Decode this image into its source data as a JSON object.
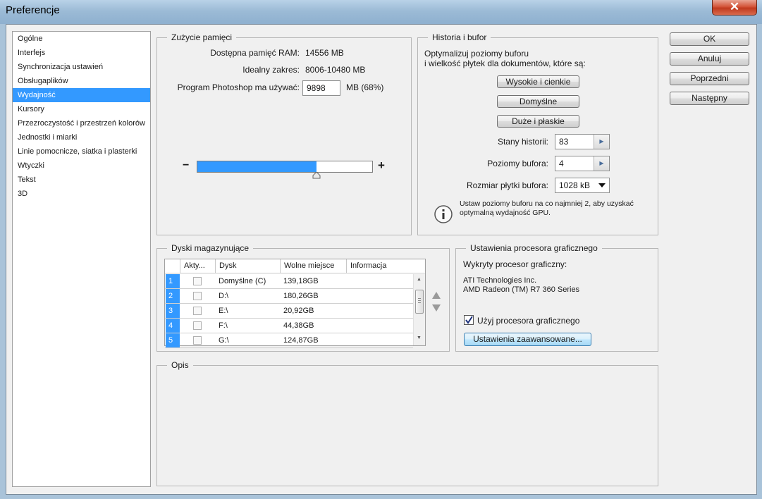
{
  "window": {
    "title": "Preferencje",
    "close": "✕"
  },
  "categories": [
    {
      "label": "Ogólne"
    },
    {
      "label": "Interfejs"
    },
    {
      "label": "Synchronizacja ustawień"
    },
    {
      "label": "Obsługaplików"
    },
    {
      "label": "Wydajność"
    },
    {
      "label": "Kursory"
    },
    {
      "label": "Przezroczystość i przestrzeń kolorów"
    },
    {
      "label": "Jednostki i miarki"
    },
    {
      "label": "Linie pomocnicze, siatka i plasterki"
    },
    {
      "label": "Wtyczki"
    },
    {
      "label": "Tekst"
    },
    {
      "label": "3D"
    }
  ],
  "selected_category": "Wydajność",
  "memory": {
    "title": "Zużycie pamięci",
    "available_label": "Dostępna pamięć RAM:",
    "available_value": "14556 MB",
    "ideal_label": "Idealny zakres:",
    "ideal_value": "8006-10480 MB",
    "use_label": "Program Photoshop ma używać:",
    "use_value": "9898",
    "use_suffix": "MB (68%)",
    "minus": "−",
    "plus": "+",
    "slider_fraction": 0.68
  },
  "history": {
    "title": "Historia i bufor",
    "desc_line1": "Optymalizuj poziomy buforu",
    "desc_line2": "i wielkość płytek dla dokumentów, które są:",
    "btn_tall_thin": "Wysokie i cienkie",
    "btn_default": "Domyślne",
    "btn_big_flat": "Duże i płaskie",
    "history_states_label": "Stany historii:",
    "history_states_value": "83",
    "cache_levels_label": "Poziomy bufora:",
    "cache_levels_value": "4",
    "tile_size_label": "Rozmiar płytki bufora:",
    "tile_size_value": "1028 kB",
    "info_line1": "Ustaw poziomy buforu na co najmniej 2, aby uzyskać",
    "info_line2": "optymalną wydajność GPU."
  },
  "scratch": {
    "title": "Dyski magazynujące",
    "columns": [
      "Akty...",
      "Dysk",
      "Wolne miejsce",
      "Informacja"
    ],
    "rows": [
      {
        "num": "1",
        "disk": "Domyślne (C)",
        "free": "139,18GB"
      },
      {
        "num": "2",
        "disk": "D:\\",
        "free": "180,26GB"
      },
      {
        "num": "3",
        "disk": "E:\\",
        "free": "20,92GB"
      },
      {
        "num": "4",
        "disk": "F:\\",
        "free": "44,38GB"
      },
      {
        "num": "5",
        "disk": "G:\\",
        "free": "124,87GB"
      }
    ]
  },
  "gpu": {
    "title": "Ustawienia procesora graficznego",
    "detected_label": "Wykryty procesor graficzny:",
    "vendor": "ATI Technologies Inc.",
    "model": "AMD Radeon (TM) R7 360 Series",
    "use_gpu_label": "Użyj procesora graficznego",
    "use_gpu_checked": true,
    "advanced_button": "Ustawienia zaawansowane..."
  },
  "description": {
    "title": "Opis"
  },
  "actions": {
    "ok": "OK",
    "cancel": "Anuluj",
    "prev": "Poprzedni",
    "next": "Następny"
  }
}
